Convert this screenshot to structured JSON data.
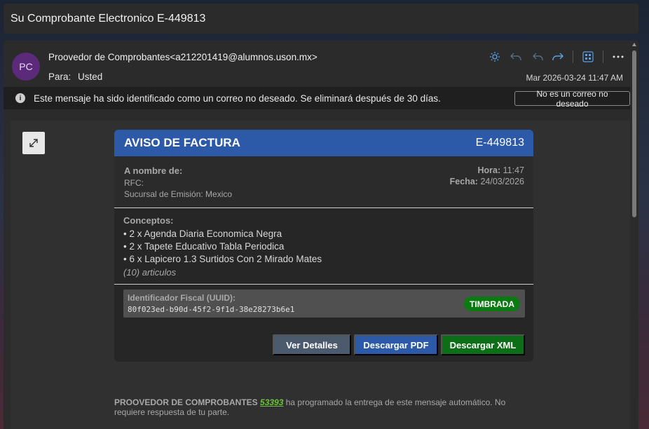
{
  "subject": "Su Comprobante Electronico E-449813",
  "header": {
    "avatar_initials": "PC",
    "from": "Proovedor de Comprobantes<a212201419@alumnos.uson.mx>",
    "to_label": "Para:",
    "to_value": "Usted",
    "date": "Mar 2026-03-24 11:47 AM",
    "toolbar_icons": [
      "sun-icon",
      "reply-icon",
      "reply-all-icon",
      "forward-icon",
      "apps-icon",
      "more-icon"
    ]
  },
  "junk_banner": {
    "text": "Este mensaje ha sido identificado como un correo no deseado. Se eliminará después de 30 días.",
    "button": "No es un correo no deseado"
  },
  "invoice": {
    "title": "AVISO DE FACTURA",
    "id": "E-449813",
    "nombre_label": "A nombre de:",
    "rfc_label": "RFC:",
    "sucursal": "Sucursal de Emisión: Mexico",
    "hora_label": "Hora:",
    "hora": "11:47",
    "fecha_label": "Fecha:",
    "fecha": "24/03/2026",
    "conceptos_label": "Conceptos:",
    "items": [
      "• 2 x Agenda Diaria Economica Negra",
      "• 2 x Tapete Educativo Tabla Periodica",
      "• 6 x Lapicero 1.3 Surtidos Con 2 Mirado Mates"
    ],
    "articulos": "(10) articulos",
    "uuid_label": "Identificador Fiscal (UUID):",
    "uuid": "80f023ed-b90d-45f2-9f1d-38e28273b6e1",
    "status": "TIMBRADA",
    "buttons": {
      "details": "Ver Detalles",
      "pdf": "Descargar PDF",
      "xml": "Descargar XML"
    }
  },
  "footer": {
    "company": "PROOVEDOR DE COMPROBANTES",
    "number": "53393",
    "text1": " ha programado    la entrega de  este mensaje automático. No",
    "text2": "requiere respuesta  de tu parte."
  },
  "colors": {
    "header_blue": "#2c5aa8",
    "status_green": "#0b7a12",
    "avatar_purple": "#5c2a7a",
    "link_green": "#6dc23a"
  }
}
